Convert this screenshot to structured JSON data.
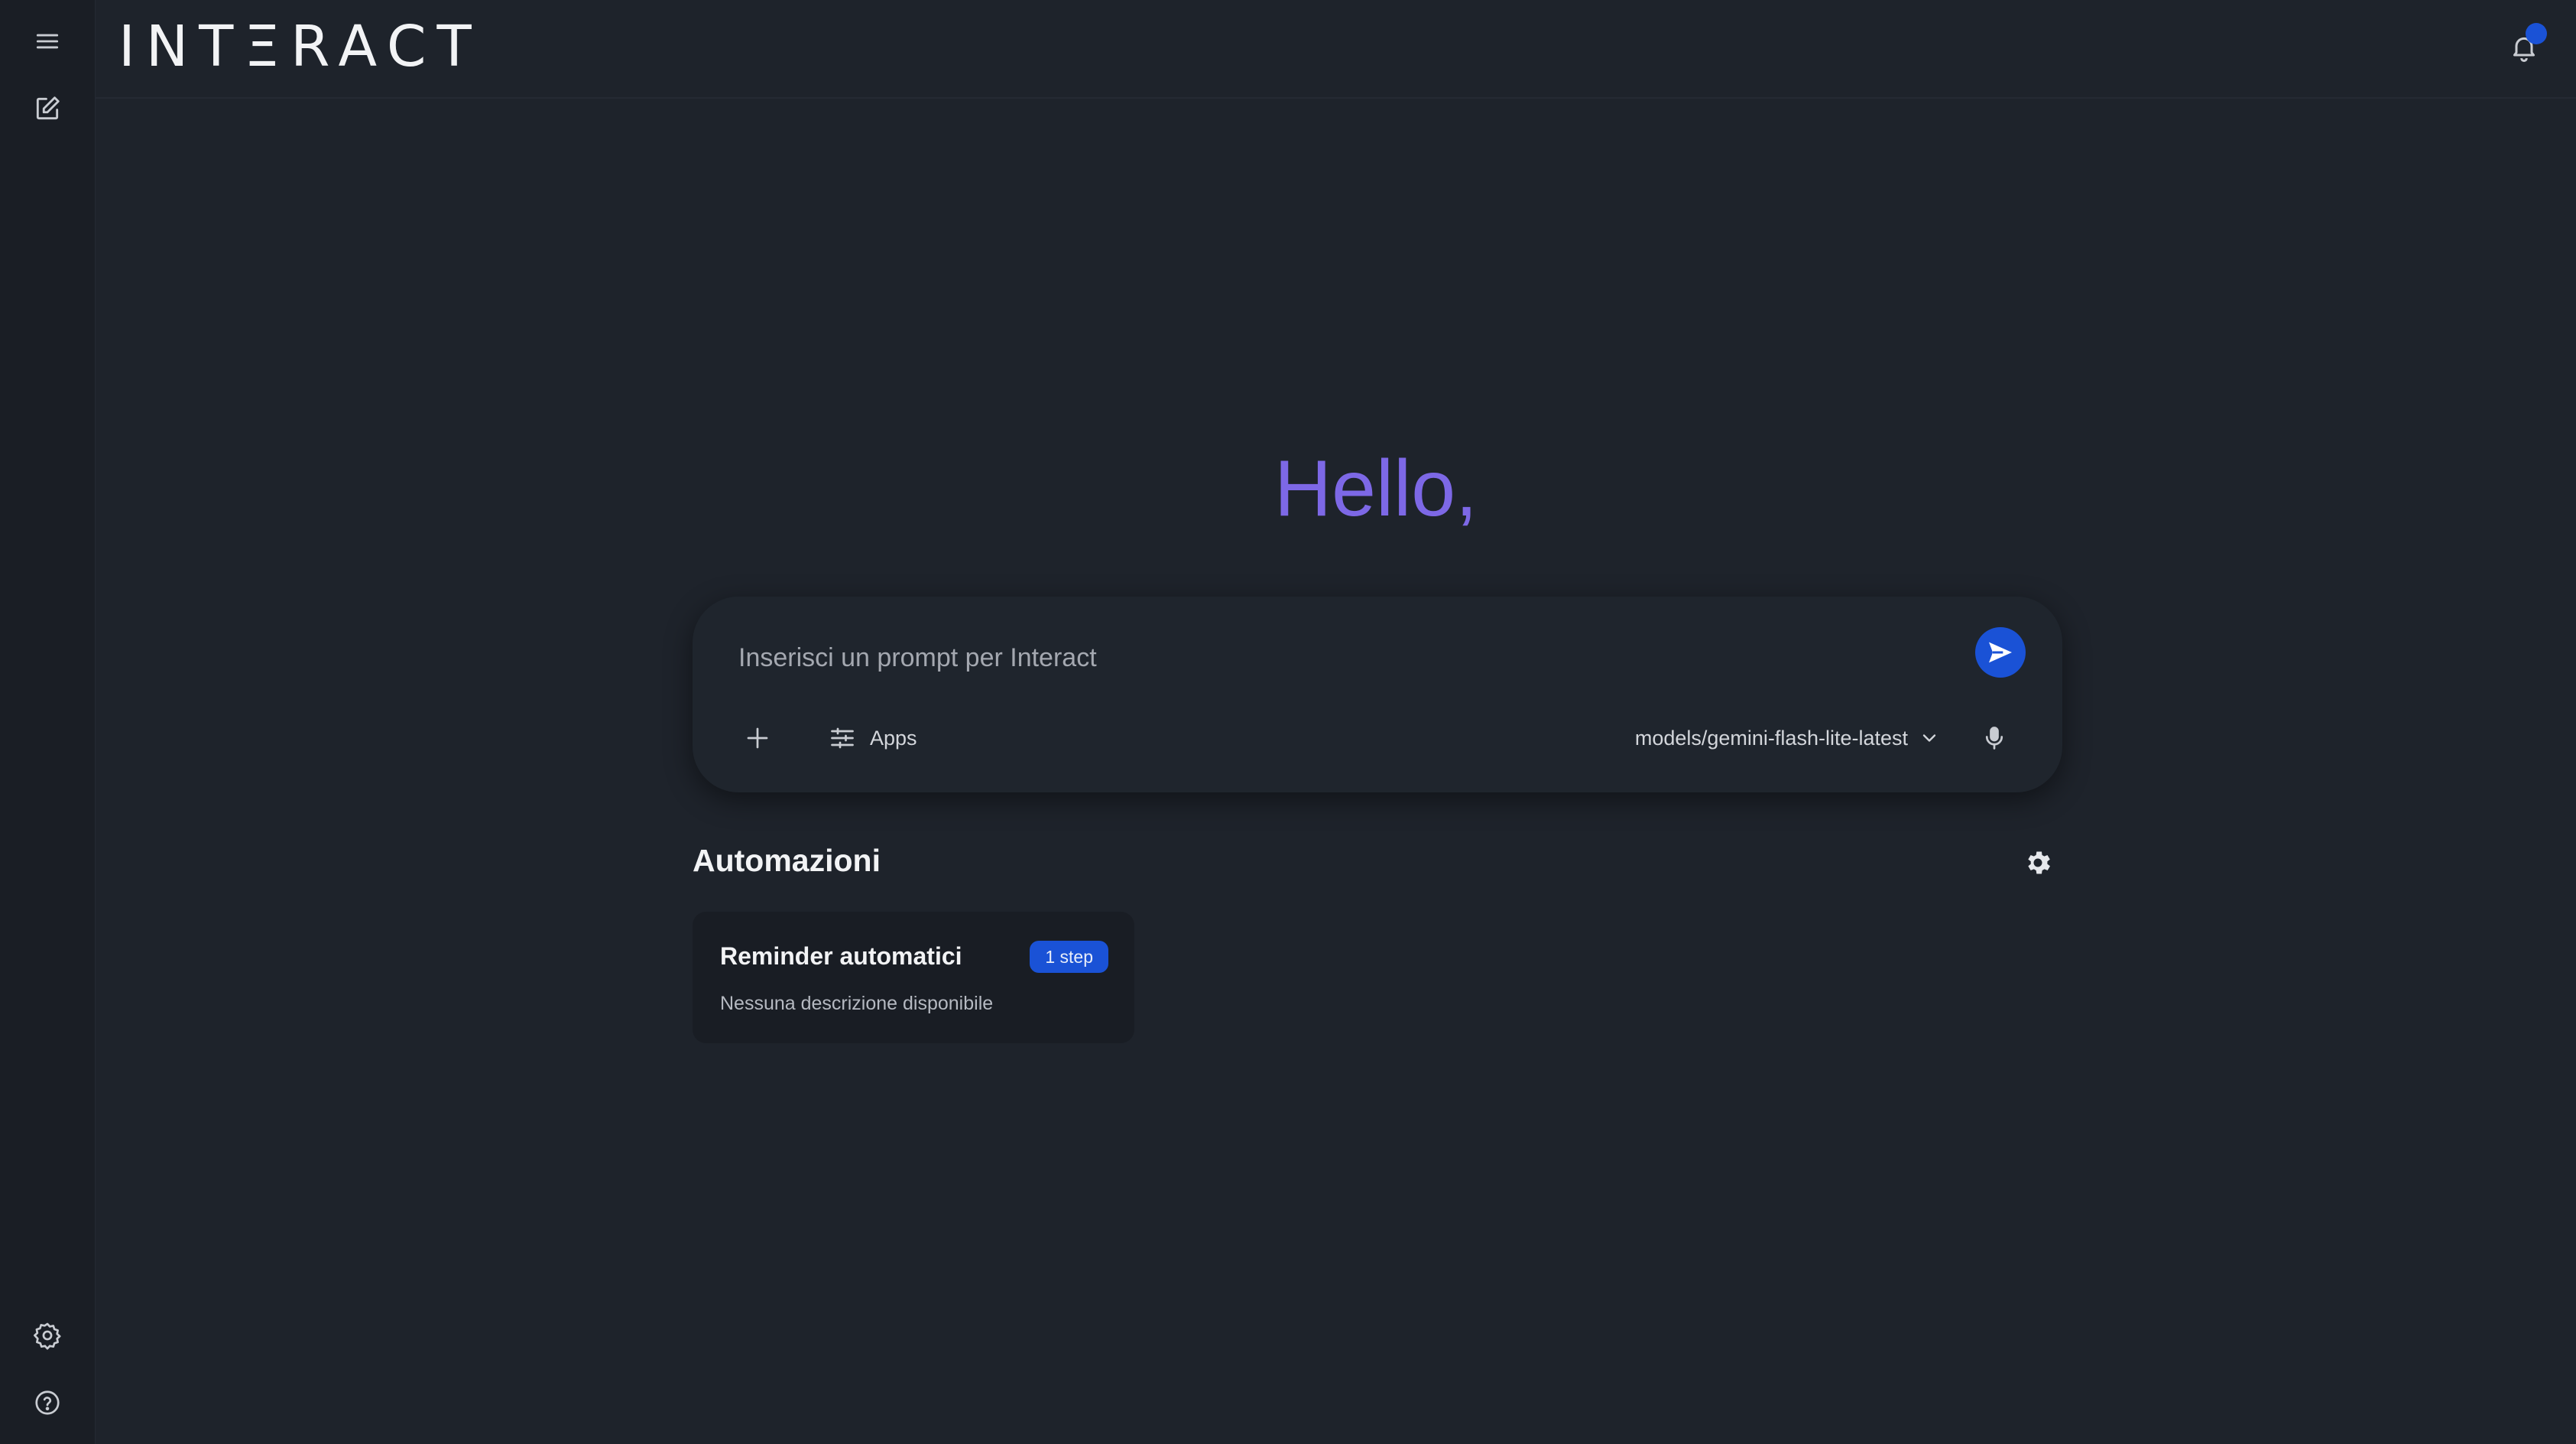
{
  "header": {
    "logo": "INTΞRACT",
    "notification_badge": true
  },
  "rail": {
    "top_items": [
      {
        "icon": "menu-icon"
      },
      {
        "icon": "new-chat-icon"
      }
    ],
    "bottom_items": [
      {
        "icon": "settings-icon"
      },
      {
        "icon": "help-icon"
      }
    ]
  },
  "main": {
    "greeting": "Hello,",
    "prompt": {
      "placeholder": "Inserisci un prompt per Interact",
      "apps_label": "Apps",
      "model": "models/gemini-flash-lite-latest"
    },
    "automations": {
      "title": "Automazioni",
      "cards": [
        {
          "title": "Reminder automatici",
          "badge": "1 step",
          "description": "Nessuna descrizione disponibile"
        }
      ]
    }
  },
  "colors": {
    "background": "#1e232b",
    "rail": "#1a1e25",
    "accent": "#1a52d6",
    "greeting": "#7d68e6"
  }
}
